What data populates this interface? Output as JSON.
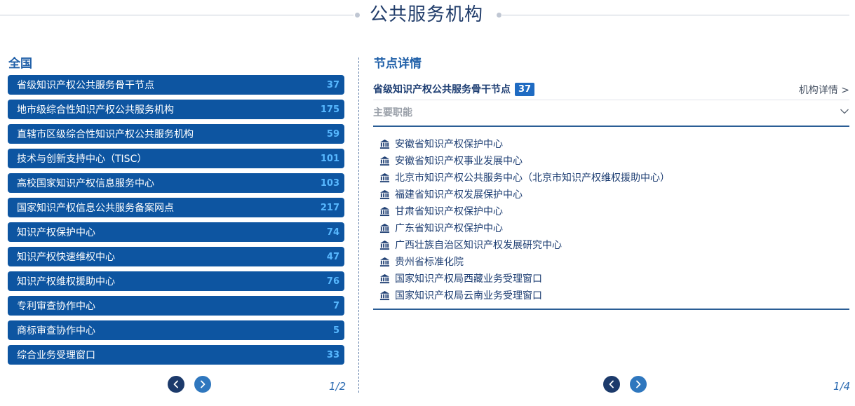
{
  "header": {
    "title": "公共服务机构"
  },
  "left": {
    "region_title": "全国",
    "categories": [
      {
        "label": "省级知识产权公共服务骨干节点",
        "count": "37"
      },
      {
        "label": "地市级综合性知识产权公共服务机构",
        "count": "175"
      },
      {
        "label": "直辖市区级综合性知识产权公共服务机构",
        "count": "59"
      },
      {
        "label": "技术与创新支持中心（TISC）",
        "count": "101"
      },
      {
        "label": "高校国家知识产权信息服务中心",
        "count": "103"
      },
      {
        "label": "国家知识产权信息公共服务备案网点",
        "count": "217"
      },
      {
        "label": "知识产权保护中心",
        "count": "74"
      },
      {
        "label": "知识产权快速维权中心",
        "count": "47"
      },
      {
        "label": "知识产权维权援助中心",
        "count": "76"
      },
      {
        "label": "专利审查协作中心",
        "count": "7"
      },
      {
        "label": "商标审查协作中心",
        "count": "5"
      },
      {
        "label": "综合业务受理窗口",
        "count": "33"
      }
    ],
    "pager": {
      "indicator": "1/2",
      "prev_icon": "chevron-left-icon",
      "next_icon": "chevron-right-icon"
    }
  },
  "right": {
    "title": "节点详情",
    "node": {
      "name": "省级知识产权公共服务骨干节点",
      "count": "37",
      "detail_link": "机构详情 >"
    },
    "duty": {
      "label": "主要职能",
      "icon": "chevron-down-icon"
    },
    "orgs": [
      "安徽省知识产权保护中心",
      "安徽省知识产权事业发展中心",
      "北京市知识产权公共服务中心（北京市知识产权维权援助中心）",
      "福建省知识产权发展保护中心",
      "甘肃省知识产权保护中心",
      "广东省知识产权保护中心",
      "广西壮族自治区知识产权发展研究中心",
      "贵州省标准化院",
      "国家知识产权局西藏业务受理窗口",
      "国家知识产权局云南业务受理窗口"
    ],
    "org_icon": "institution-building-icon",
    "pager": {
      "indicator": "1/4"
    }
  },
  "colors": {
    "accent": "#0d55a1",
    "count_text": "#58b8ff",
    "title_blue": "#1f5fa8",
    "badge": "#1f6bc2",
    "pager_prev": "#1c3a6b",
    "pager_next": "#2f77be"
  }
}
